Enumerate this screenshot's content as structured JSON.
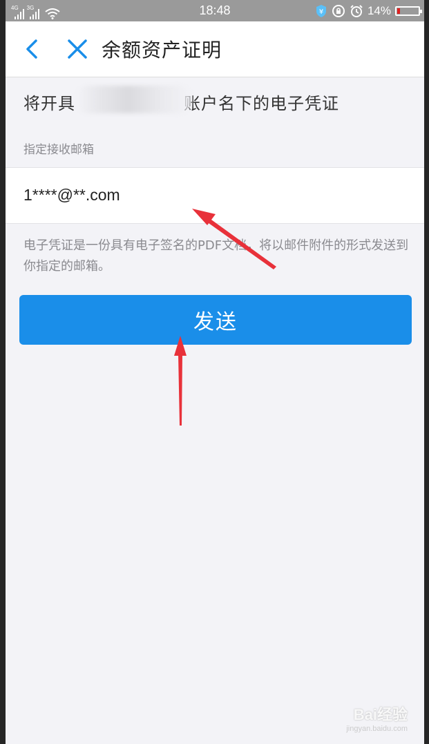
{
  "status_bar": {
    "network_1": "4G",
    "network_2": "3G",
    "time": "18:48",
    "battery": "14%",
    "battery_level": 0.14
  },
  "nav": {
    "title": "余额资产证明",
    "back_icon": "chevron-left-icon",
    "close_icon": "close-icon"
  },
  "intro": {
    "text_before": "将开具",
    "text_after": "账户名下的电子凭证"
  },
  "email_field": {
    "label": "指定接收邮箱",
    "value": "1****@**.com"
  },
  "note": "电子凭证是一份具有电子签名的PDF文档，将以邮件附件的形式发送到你指定的邮箱。",
  "send_button": {
    "label": "发送"
  },
  "watermark": {
    "main": "Bai经验",
    "sub": "jingyan.baidu.com"
  },
  "colors": {
    "accent": "#1a8ee9",
    "annotation": "#e8313a",
    "background": "#f3f3f7"
  }
}
